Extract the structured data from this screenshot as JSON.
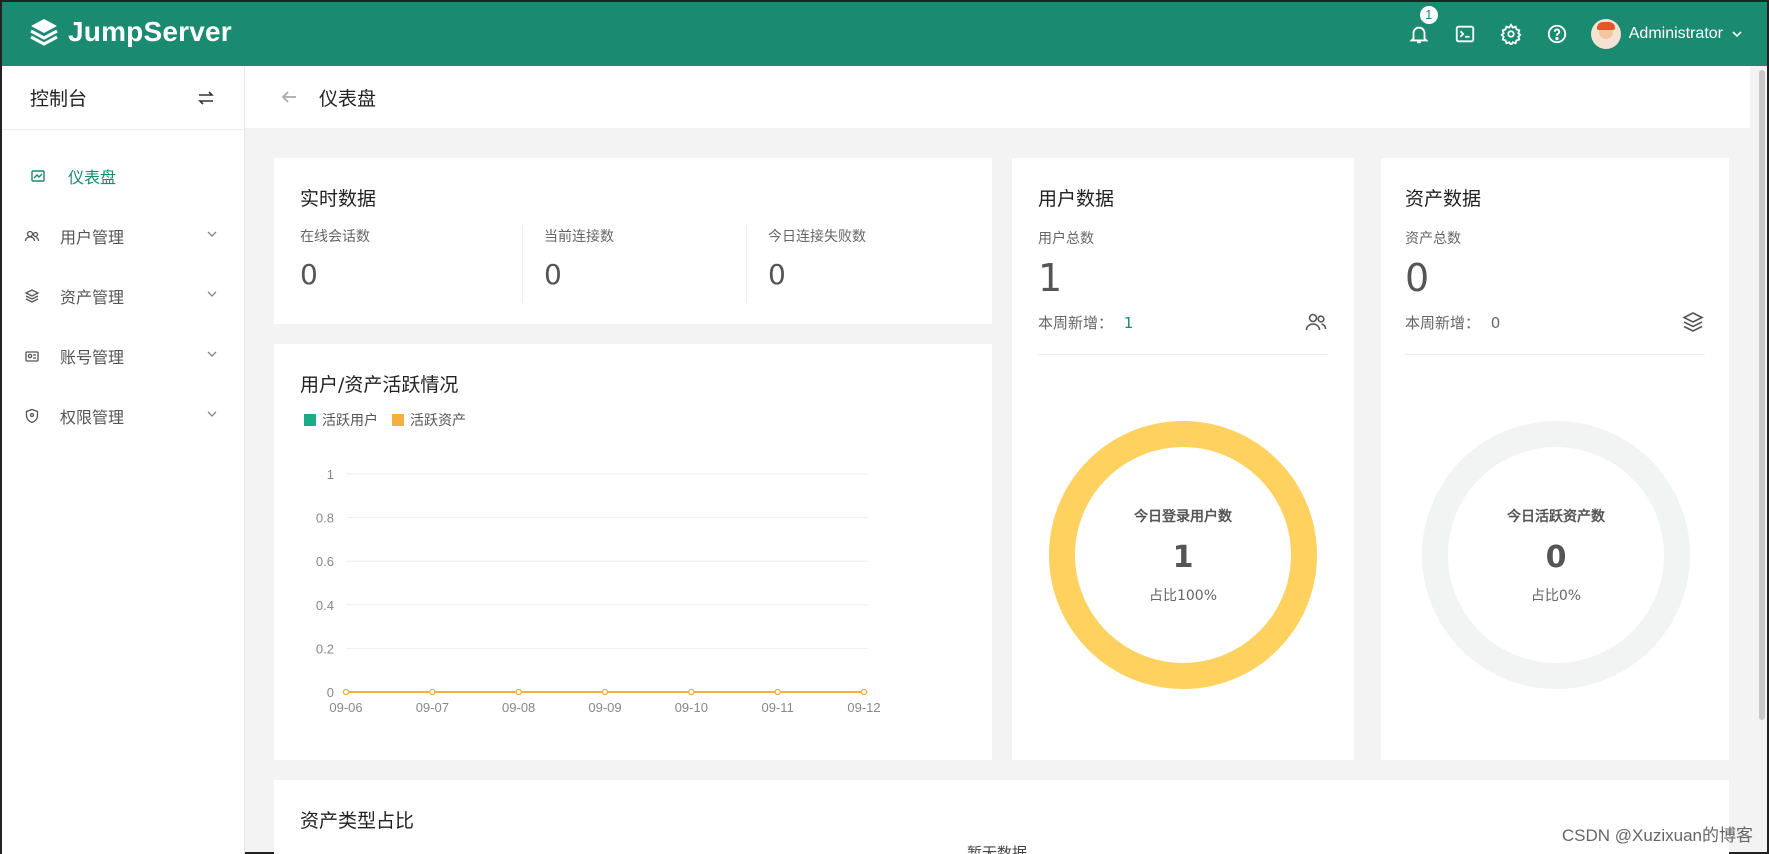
{
  "brand": {
    "name": "JumpServer"
  },
  "topbar": {
    "notification_count": "1",
    "username": "Administrator",
    "colors": {
      "primary": "#1a8a70"
    }
  },
  "sidebar": {
    "title": "控制台",
    "items": [
      {
        "label": "仪表盘",
        "icon": "dashboard-icon",
        "active": true
      },
      {
        "label": "用户管理",
        "icon": "users-icon"
      },
      {
        "label": "资产管理",
        "icon": "layers-icon"
      },
      {
        "label": "账号管理",
        "icon": "account-icon"
      },
      {
        "label": "权限管理",
        "icon": "shield-icon"
      }
    ]
  },
  "page": {
    "title": "仪表盘"
  },
  "realtime": {
    "title": "实时数据",
    "stats": [
      {
        "label": "在线会话数",
        "value": "0"
      },
      {
        "label": "当前连接数",
        "value": "0"
      },
      {
        "label": "今日连接失败数",
        "value": "0"
      }
    ]
  },
  "activity": {
    "title": "用户/资产活跃情况",
    "legend": [
      {
        "label": "活跃用户",
        "color": "#1aab87"
      },
      {
        "label": "活跃资产",
        "color": "#f4b03e"
      }
    ]
  },
  "chart_data": {
    "type": "line",
    "x": [
      "09-06",
      "09-07",
      "09-08",
      "09-09",
      "09-10",
      "09-11",
      "09-12"
    ],
    "series": [
      {
        "name": "活跃用户",
        "values": [
          0,
          0,
          0,
          0,
          0,
          0,
          0
        ],
        "color": "#1aab87"
      },
      {
        "name": "活跃资产",
        "values": [
          0,
          0,
          0,
          0,
          0,
          0,
          0
        ],
        "color": "#f4b03e"
      }
    ],
    "yticks": [
      "0",
      "0.2",
      "0.4",
      "0.6",
      "0.8",
      "1"
    ],
    "ylim": [
      0,
      1
    ],
    "grid": true,
    "legend": "top-left"
  },
  "user_data": {
    "title": "用户数据",
    "total_label": "用户总数",
    "total": "1",
    "weekly_label": "本周新增：",
    "weekly": "1",
    "donut_label": "今日登录用户数",
    "donut_value": "1",
    "donut_pct": "占比100%",
    "ring_fraction": 1.0,
    "ring_color": "#ffd15f"
  },
  "asset_data": {
    "title": "资产数据",
    "total_label": "资产总数",
    "total": "0",
    "weekly_label": "本周新增：",
    "weekly": "0",
    "donut_label": "今日活跃资产数",
    "donut_value": "0",
    "donut_pct": "占比0%",
    "ring_fraction": 0,
    "ring_color": "#f1f4f2"
  },
  "asset_types": {
    "title": "资产类型占比",
    "empty": "暂无数据"
  },
  "watermark": "CSDN @Xuzixuan的博客"
}
